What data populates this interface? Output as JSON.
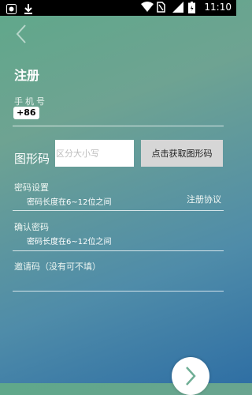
{
  "statusbar": {
    "time": "11:10",
    "icons": [
      "app-notification-icon",
      "download-icon",
      "wifi-icon",
      "sim-icon",
      "signal-icon",
      "battery-icon"
    ]
  },
  "header": {
    "title": "注册"
  },
  "phone": {
    "label": "手机号",
    "country_code": "+86"
  },
  "captcha": {
    "label": "图形码",
    "placeholder": "区分大小写",
    "button_label": "点击获取图形码"
  },
  "password": {
    "label": "密码设置",
    "hint": "密码长度在6~12位之间"
  },
  "agreement": {
    "label": "注册协议"
  },
  "confirm_password": {
    "label": "确认密码",
    "hint": "密码长度在6~12位之间"
  },
  "invite": {
    "label": "邀请码（没有可不填）"
  },
  "colors": {
    "background_top": "#5fa88a",
    "background_bottom": "#2f6fa4",
    "captcha_button": "#d6d6d6",
    "statusbar": "#000000"
  }
}
